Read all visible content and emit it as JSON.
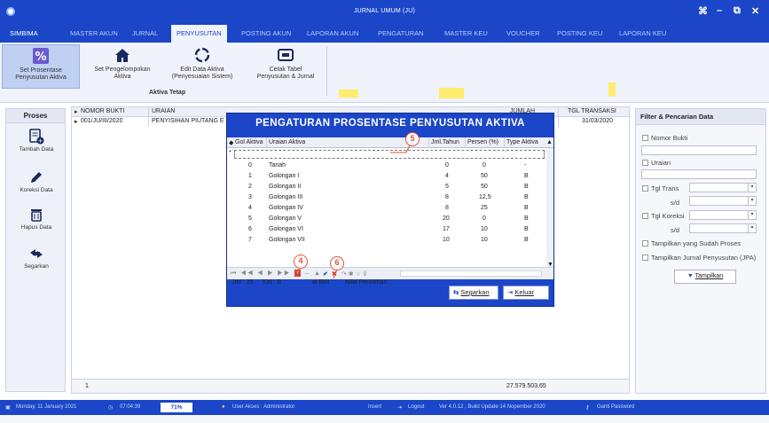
{
  "window": {
    "title": "JURNAL UMUM (JU)",
    "controls": [
      "⌘",
      "–",
      "⧉",
      "✕"
    ]
  },
  "menu": [
    "SIMBIMA",
    "MASTER AKUN",
    "JURNAL",
    "PENYUSUTAN",
    "POSTING AKUN",
    "LAPORAN AKUN",
    "PENGATURAN",
    "MASTER KEU",
    "VOUCHER",
    "POSTING KEU",
    "LAPORAN KEU"
  ],
  "ribbon": {
    "buttons": [
      {
        "line1": "Set Prosentase",
        "line2": "Penyusutan Aktiva",
        "icon": "percent-icon"
      },
      {
        "line1": "Set Pengelompokan",
        "line2": "Aktiva",
        "icon": "home-icon"
      },
      {
        "line1": "Edit Data Aktiva",
        "line2": "(Penyesuaian Sistem)",
        "icon": "refresh-icon"
      },
      {
        "line1": "Cetak Tabel",
        "line2": "Penyusutan & Jurnal",
        "icon": "print-icon"
      }
    ],
    "group_label": "Aktiva Tetap"
  },
  "left_panel": {
    "title": "Proses",
    "buttons": [
      {
        "label": "Tambah Data",
        "icon": "add-doc-icon"
      },
      {
        "label": "Koreksi Data",
        "icon": "pencil-icon"
      },
      {
        "label": "Hapus Data",
        "icon": "trash-icon"
      },
      {
        "label": "Segarkan",
        "icon": "refresh-arrows-icon"
      }
    ]
  },
  "main_grid": {
    "columns": [
      "NOMOR BUKTI",
      "URAIAN",
      "TGL TRANSAKSI"
    ],
    "partial_header": "JUMLAH",
    "rows": [
      {
        "nomor": "001/JU/III/2020",
        "uraian": "PENYISIHAN PIUTANG E",
        "tgl": "31/03/2020"
      }
    ],
    "footer_count": "1",
    "footer_total": "27.579.503,65"
  },
  "filter_panel": {
    "title": "Filter & Pencarian Data",
    "nomor_bukti": "Nomor Bukti",
    "uraian": "Uraian",
    "tgl_trans": "Tgl Trans",
    "sd1": "s/d",
    "tgl_koreksi": "Tgl Koreksi",
    "sd2": "s/d",
    "opt1": "Tampilkan yang Sudah Proses",
    "opt2": "Tampilkan Jurnal Penyusutan (JPA)",
    "button": "Tampilkan"
  },
  "dialog": {
    "title": "PENGATURAN PROSENTASE PENYUSUTAN AKTIVA",
    "columns": [
      "Gol Aktiva",
      "Uraian Aktiva",
      "Jml.Tahun",
      "Persen (%)",
      "Type Aktiva"
    ],
    "rows": [
      {
        "gol": "0",
        "uraian": "Tanah",
        "tahun": "0",
        "persen": "0",
        "type": "-"
      },
      {
        "gol": "1",
        "uraian": "Golongan I",
        "tahun": "4",
        "persen": "50",
        "type": "B"
      },
      {
        "gol": "2",
        "uraian": "Golongan II",
        "tahun": "5",
        "persen": "50",
        "type": "B"
      },
      {
        "gol": "3",
        "uraian": "Golongan III",
        "tahun": "8",
        "persen": "12,5",
        "type": "B"
      },
      {
        "gol": "4",
        "uraian": "Golongan IV",
        "tahun": "8",
        "persen": "25",
        "type": "B"
      },
      {
        "gol": "5",
        "uraian": "Golongan V",
        "tahun": "20",
        "persen": "0",
        "type": "B"
      },
      {
        "gol": "6",
        "uraian": "Golongan VI",
        "tahun": "17",
        "persen": "10",
        "type": "B"
      },
      {
        "gol": "7",
        "uraian": "Golongan VII",
        "tahun": "10",
        "persen": "10",
        "type": "B"
      }
    ],
    "jml": "Jml : 25",
    "ket_prefix": "Ket : B",
    "ket_mid": "ai Beli",
    "ket_suffix": "Nilai Perolehan",
    "buttons": {
      "segarkan": "Segarkan",
      "keluar": "Keluar"
    }
  },
  "badges": [
    "4",
    "5",
    "6"
  ],
  "status": {
    "date": "Monday, 11 January 2021",
    "time": "07:04:39",
    "percent": "71%",
    "user": "User Akses : Administrator",
    "insert": "Insert",
    "logout": "Logout",
    "version": "Ver 4.0.12 , Build Update 14 Nopember 2020",
    "ganti": "Ganti Password"
  },
  "colors": {
    "accent": "#1b46c8",
    "ribbon": "#f0f3fb",
    "badge": "#e54d3c",
    "highlight": "#ffec6e"
  }
}
